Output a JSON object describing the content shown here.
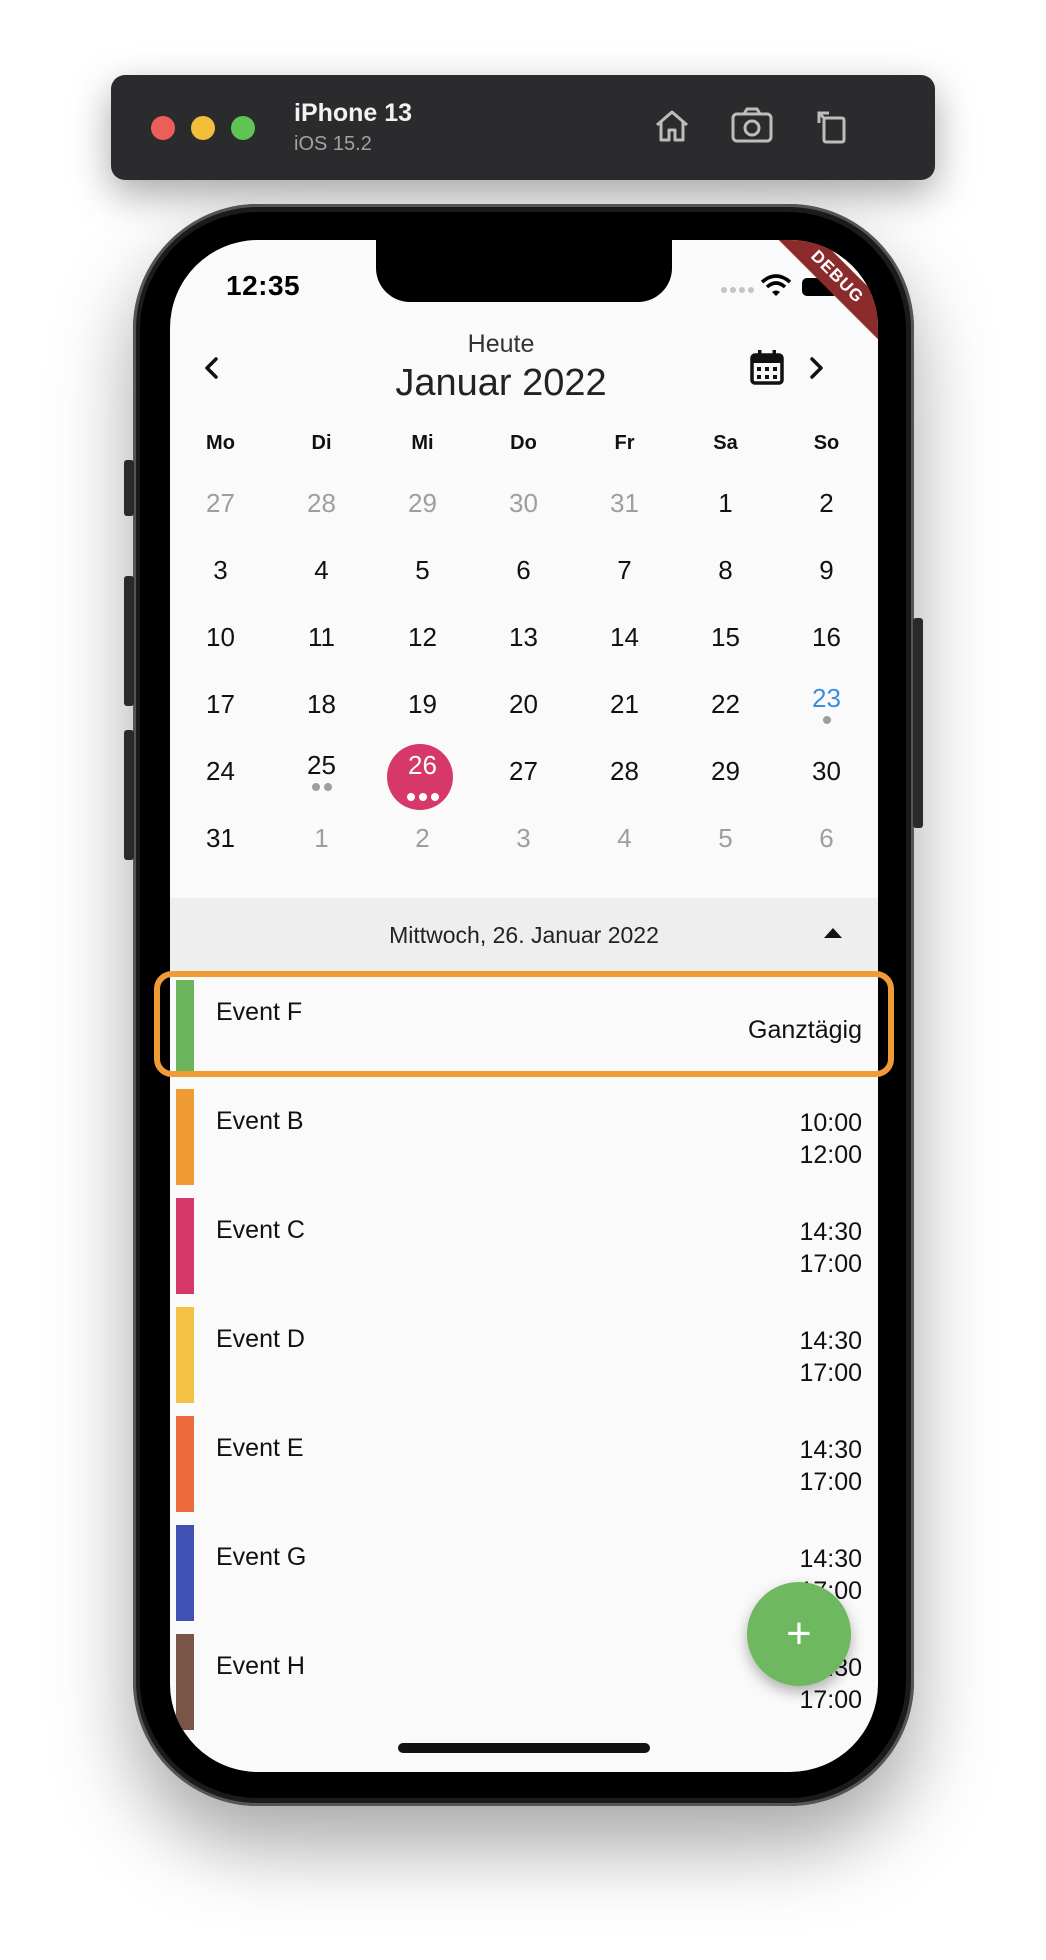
{
  "simulator": {
    "device_name": "iPhone 13",
    "os_version": "iOS 15.2"
  },
  "status_bar": {
    "time": "12:35"
  },
  "debug_banner": "DEBUG",
  "calendar": {
    "today_label": "Heute",
    "month_label": "Januar 2022",
    "weekdays": [
      "Mo",
      "Di",
      "Mi",
      "Do",
      "Fr",
      "Sa",
      "So"
    ],
    "weeks": [
      [
        "27",
        "28",
        "29",
        "30",
        "31",
        "1",
        "2"
      ],
      [
        "3",
        "4",
        "5",
        "6",
        "7",
        "8",
        "9"
      ],
      [
        "10",
        "11",
        "12",
        "13",
        "14",
        "15",
        "16"
      ],
      [
        "17",
        "18",
        "19",
        "20",
        "21",
        "22",
        "23"
      ],
      [
        "24",
        "25",
        "26",
        "27",
        "28",
        "29",
        "30"
      ],
      [
        "31",
        "1",
        "2",
        "3",
        "4",
        "5",
        "6"
      ]
    ],
    "selected_day": "26",
    "today_day": "23"
  },
  "selected_date_label": "Mittwoch, 26. Januar 2022",
  "events": [
    {
      "title": "Event F",
      "time": "Ganztägig",
      "color": "#6bb55d"
    },
    {
      "title": "Event B",
      "start": "10:00",
      "end": "12:00",
      "color": "#ef9c37"
    },
    {
      "title": "Event C",
      "start": "14:30",
      "end": "17:00",
      "color": "#d6386a"
    },
    {
      "title": "Event D",
      "start": "14:30",
      "end": "17:00",
      "color": "#f4c243"
    },
    {
      "title": "Event E",
      "start": "14:30",
      "end": "17:00",
      "color": "#ec6a3c"
    },
    {
      "title": "Event G",
      "start": "14:30",
      "end": "17:00",
      "color": "#3f51b5"
    },
    {
      "title": "Event H",
      "start": "14:30",
      "end": "17:00",
      "color": "#795548"
    }
  ],
  "fab": {
    "icon": "plus-icon",
    "label": "+"
  }
}
